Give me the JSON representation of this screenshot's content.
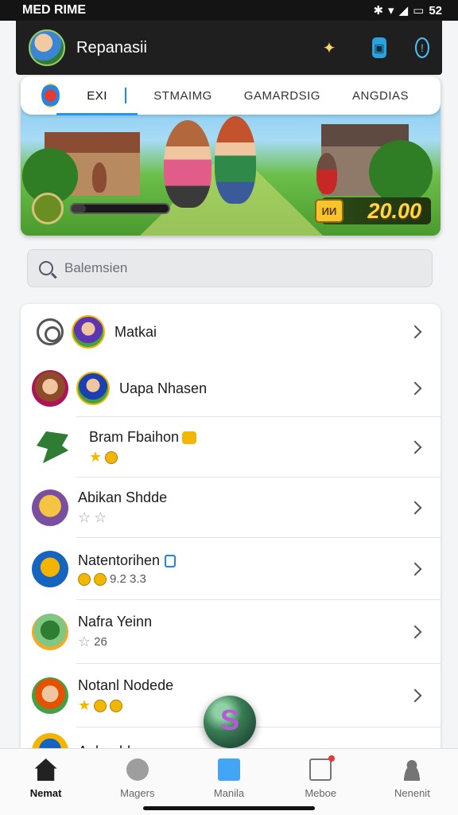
{
  "status_bar": {
    "left": "MED RIME",
    "right": "52"
  },
  "header": {
    "title": "Repanasii"
  },
  "banner": {
    "tabs": [
      {
        "label": "EXI",
        "active": true
      },
      {
        "label": "STMAIMG",
        "active": false
      },
      {
        "label": "GAMARDSIG",
        "active": false
      },
      {
        "label": "ANGDIAS",
        "active": false
      }
    ],
    "score": "20.00",
    "score_badge": "ИИ",
    "progress": 0.15
  },
  "search": {
    "placeholder": "Balemsien"
  },
  "list": [
    {
      "name": "Matkai",
      "meta": ""
    },
    {
      "name": "Uapa Nhasen",
      "meta": ""
    },
    {
      "name": "Bram Fbaihon",
      "meta": ""
    },
    {
      "name": "Abikan Shdde",
      "meta": ""
    },
    {
      "name": "Natentorihen",
      "meta": "9.2 3.3"
    },
    {
      "name": "Nafra Yeinn",
      "meta": "26"
    },
    {
      "name": "Notanl Nodede",
      "meta": ""
    },
    {
      "name": "Aakre bbe",
      "meta": ""
    }
  ],
  "bottom_nav": [
    {
      "label": "Nemat",
      "icon": "home-icon",
      "active": true
    },
    {
      "label": "Magers",
      "icon": "ball-icon",
      "active": false
    },
    {
      "label": "Manila",
      "icon": "flag-icon",
      "active": false
    },
    {
      "label": "Meboe",
      "icon": "document-icon",
      "active": false
    },
    {
      "label": "Nenenit",
      "icon": "user-icon",
      "active": false
    }
  ],
  "colors": {
    "accent": "#2196f3",
    "score": "#ffd740",
    "header_bg": "#1f1f1f"
  }
}
